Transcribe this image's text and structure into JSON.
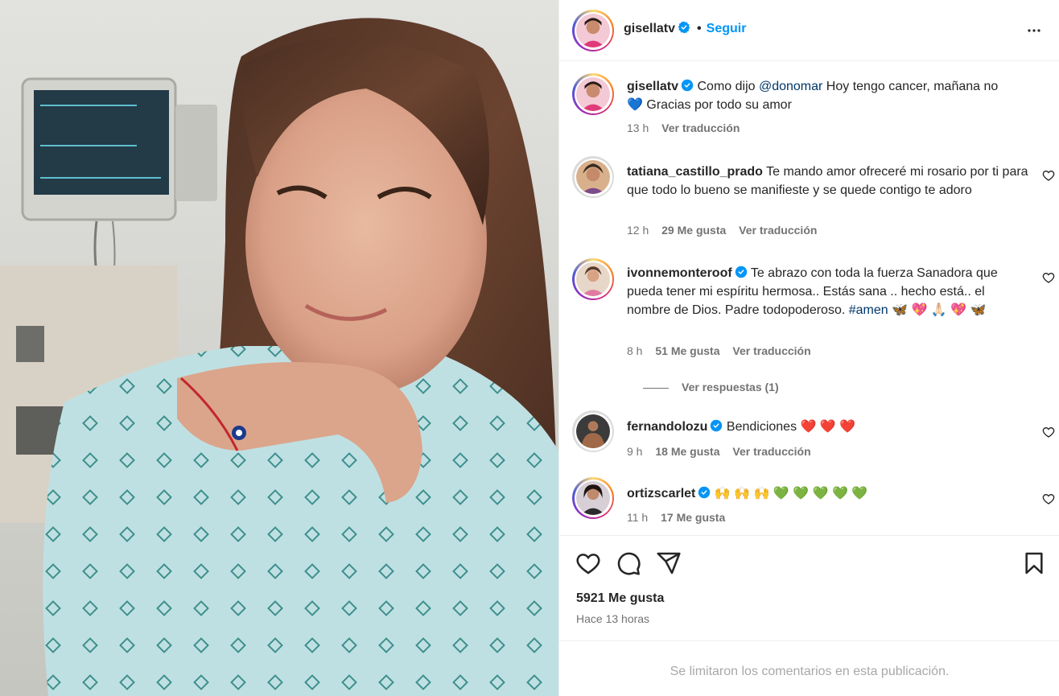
{
  "post": {
    "username": "gisellatv",
    "follow_label": "Seguir",
    "dot": "•",
    "caption": {
      "username": "gisellatv",
      "text_prefix": "Como dijo ",
      "mention": "@donomar",
      "text_suffix": " Hoy tengo cancer, mañana no",
      "line2": "💙 Gracias por todo su amor",
      "time": "13 h",
      "translate": "Ver traducción"
    },
    "likes": "5921 Me gusta",
    "time_ago": "Hace 13 horas",
    "comments_limited": "Se limitaron los comentarios en esta publicación."
  },
  "comments": [
    {
      "username": "tatiana_castillo_prado",
      "verified": false,
      "text": "Te mando amor ofreceré mi rosario por ti para que todo lo bueno se manifieste y se quede contigo te adoro",
      "time": "12 h",
      "likes": "29 Me gusta",
      "translate": "Ver traducción"
    },
    {
      "username": "ivonnemonteroof",
      "verified": true,
      "text": "Te abrazo con toda la fuerza Sanadora que pueda tener mi espíritu hermosa.. Estás sana .. hecho está.. el nombre de Dios. Padre todopoderoso. ",
      "hashtag": "#amen",
      "emoji": " 🦋 💖 🙏🏻 💖 🦋",
      "time": "8 h",
      "likes": "51 Me gusta",
      "translate": "Ver traducción",
      "replies": "Ver respuestas (1)"
    },
    {
      "username": "fernandolozu",
      "verified": true,
      "text": "Bendiciones ❤️ ❤️ ❤️",
      "time": "9 h",
      "likes": "18 Me gusta",
      "translate": "Ver traducción"
    },
    {
      "username": "ortizscarlet",
      "verified": true,
      "text": "🙌 🙌 🙌 💚 💚 💚 💚 💚",
      "time": "11 h",
      "likes": "17 Me gusta",
      "translate": ""
    }
  ],
  "icons": {
    "like": "heart-icon",
    "comment": "comment-bubble-icon",
    "share": "paper-plane-icon",
    "save": "bookmark-icon",
    "more": "more-options-icon",
    "verified": "verified-badge-icon"
  },
  "colors": {
    "link_blue": "#0095f6",
    "verified_blue": "#0095f6",
    "meta_gray": "#737373"
  }
}
